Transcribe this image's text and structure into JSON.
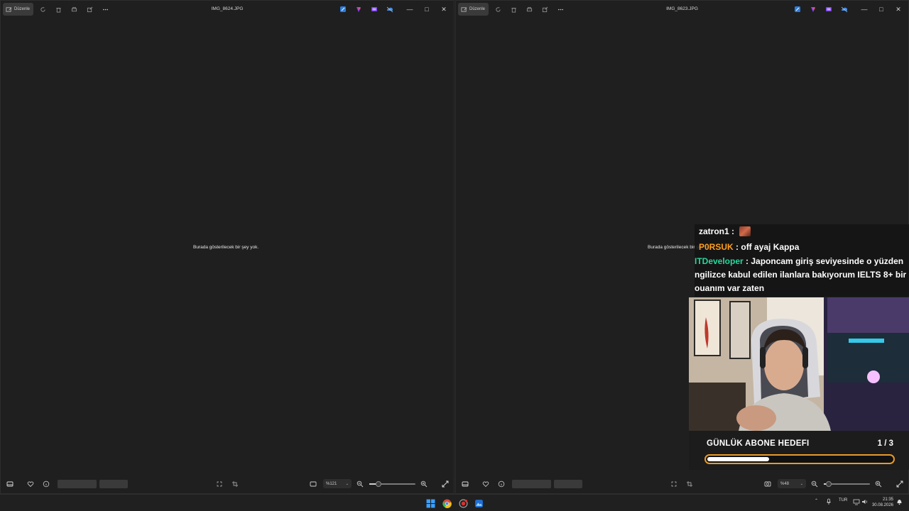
{
  "windows": [
    {
      "edit_label": "Düzenle",
      "title": "IMG_8624.JPG",
      "empty_message": "Burada gösterilecek bir şey yok.",
      "zoom": "%121",
      "zoom_level": 0.2
    },
    {
      "edit_label": "Düzenle",
      "title": "IMG_8623.JPG",
      "empty_message": "Burada gösterilecek bir şey yok.",
      "zoom": "%48",
      "zoom_level": 0.1
    }
  ],
  "chat": {
    "messages": [
      {
        "user": "zatron1",
        "user_color": "#ffffff",
        "text": "",
        "emote": true
      },
      {
        "user": "P0RSUK",
        "user_color": "#ff9e1b",
        "text": "off ayaj Kappa"
      },
      {
        "user": "ITDeveloper",
        "user_color": "#27d99b",
        "text": "Japoncam giriş seviyesinde o yüzden"
      },
      {
        "user": "",
        "user_color": "#ffffff",
        "text": "ngilizce kabul edilen ilanlara bakıyorum IELTS 8+ bir"
      },
      {
        "user": "",
        "user_color": "#ffffff",
        "text": "ouanım var zaten"
      }
    ]
  },
  "goal": {
    "label": "GÜNLÜK ABONE HEDEFI",
    "count": "1 / 3",
    "progress": 0.333
  },
  "taskbar": {
    "language": "TUR",
    "time": "21:35",
    "date": "30.08.2026"
  },
  "colors": {
    "accent_orange": "#e79a2a",
    "window_bg": "#1f1f1f"
  }
}
